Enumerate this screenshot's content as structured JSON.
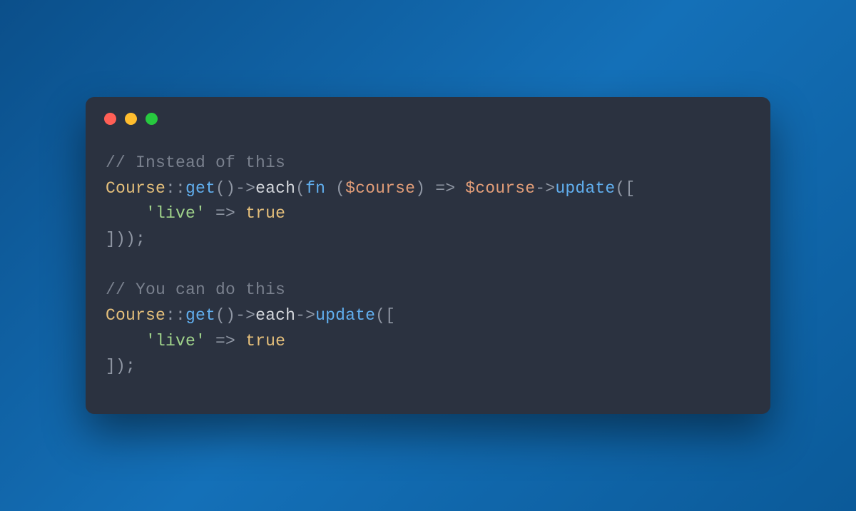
{
  "colors": {
    "window_bg": "#2b3240",
    "dot_red": "#ff5f56",
    "dot_yellow": "#ffbd2e",
    "dot_green": "#27c93f"
  },
  "code": {
    "comment1": "// Instead of this",
    "block1": {
      "class": "Course",
      "scope": "::",
      "get": "get",
      "p_open": "(",
      "p_close": ")",
      "arrow_obj": "->",
      "each": "each",
      "fn": "fn",
      "space": " ",
      "var": "$course",
      "arrow_fn": "=>",
      "update": "update",
      "br_open": "[",
      "key": "'live'",
      "bool": "true",
      "br_close": "]",
      "p2_close": ")",
      "p3_close": ")",
      "semi": ";"
    },
    "comment2": "// You can do this",
    "block2": {
      "class": "Course",
      "scope": "::",
      "get": "get",
      "p_open": "(",
      "p_close": ")",
      "arrow_obj": "->",
      "each": "each",
      "update": "update",
      "br_open": "[",
      "key": "'live'",
      "arrow_fn": "=>",
      "bool": "true",
      "br_close": "]",
      "p3_close": ")",
      "semi": ";"
    }
  }
}
